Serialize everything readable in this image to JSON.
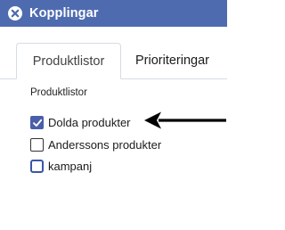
{
  "window": {
    "title": "Kopplingar",
    "logo_icon": "close-circle-icon",
    "header_color": "#4f6bb0"
  },
  "tabs": [
    {
      "label": "Produktlistor",
      "active": true
    },
    {
      "label": "Prioriteringar",
      "active": false
    }
  ],
  "section": {
    "title": "Produktlistor"
  },
  "options": [
    {
      "label": "Dolda produkter",
      "checked": true
    },
    {
      "label": "Anderssons produkter",
      "checked": false
    },
    {
      "label": "kampanj",
      "checked": false
    }
  ],
  "annotation": {
    "icon": "arrow-left-icon",
    "points_to": "Dolda produkter"
  },
  "colors": {
    "accent": "#4a5fa8",
    "text": "#1b1b1b",
    "border": "#d7dbe3"
  }
}
